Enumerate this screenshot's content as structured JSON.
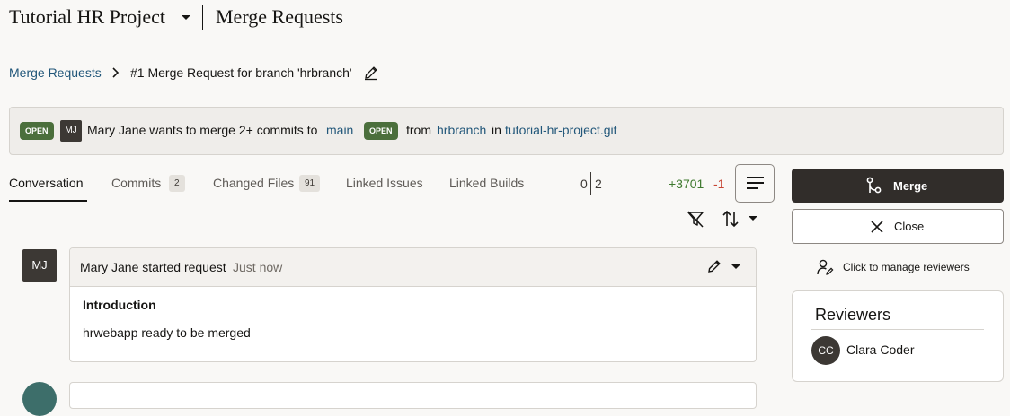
{
  "header": {
    "project": "Tutorial HR Project",
    "title": "Merge Requests"
  },
  "breadcrumb": {
    "link": "Merge Requests",
    "current": "#1 Merge Request for branch 'hrbranch'"
  },
  "banner": {
    "status_badge": "OPEN",
    "author_initials": "MJ",
    "message": "Mary Jane wants to merge 2+ commits to",
    "target_branch": "main",
    "target_badge": "OPEN",
    "from_text": "from",
    "source_branch": "hrbranch",
    "in_text": "in",
    "repository": "tutorial-hr-project.git"
  },
  "tabs": [
    {
      "label": "Conversation"
    },
    {
      "label": "Commits",
      "count": "2"
    },
    {
      "label": "Changed Files",
      "count": "91"
    },
    {
      "label": "Linked Issues"
    },
    {
      "label": "Linked Builds"
    }
  ],
  "stats": {
    "ratio_left": "0",
    "ratio_right": "2",
    "additions": "+3701",
    "deletions": "-1"
  },
  "actions": {
    "merge_label": "Merge",
    "close_label": "Close",
    "manage_reviewers": "Click to manage reviewers"
  },
  "reviewers": {
    "title": "Reviewers",
    "items": [
      {
        "initials": "CC",
        "name": "Clara Coder"
      }
    ]
  },
  "comment": {
    "avatar": "MJ",
    "author_text": "Mary Jane started request",
    "time": "Just now",
    "heading": "Introduction",
    "body": "hrwebapp ready to be merged"
  },
  "colors": {
    "accent_dark": "#312d2a",
    "link": "#22577a",
    "open_badge": "#4b6f3c",
    "additions": "#3f7a2f",
    "deletions": "#c74634"
  },
  "icons": [
    "chevron-down-icon",
    "chevron-right-icon",
    "pencil-icon",
    "hamburger-menu-icon",
    "filter-off-icon",
    "sort-icon",
    "merge-icon",
    "close-icon",
    "user-manage-icon"
  ]
}
